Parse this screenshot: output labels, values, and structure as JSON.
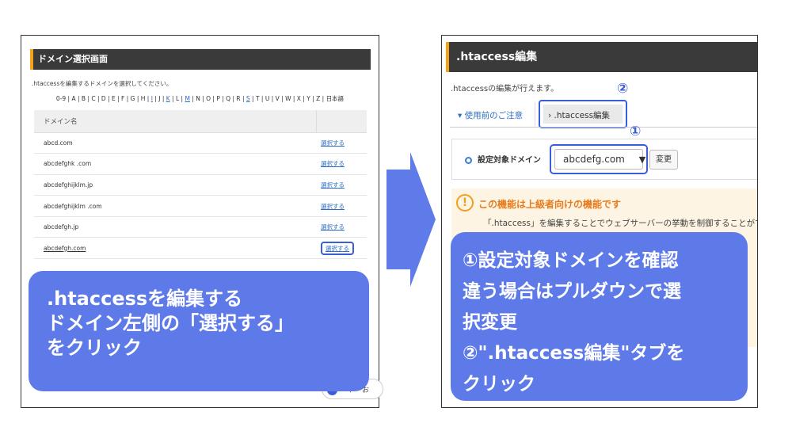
{
  "left_panel": {
    "header": "ドメイン選択画面",
    "instruction": ".htaccessを編集するドメインを選択してください。",
    "alpha_nav": [
      "0-9",
      "A",
      "B",
      "C",
      "D",
      "E",
      "F",
      "G",
      "H",
      "I",
      "J",
      "K",
      "L",
      "M",
      "N",
      "O",
      "P",
      "Q",
      "R",
      "S",
      "T",
      "U",
      "V",
      "W",
      "X",
      "Y",
      "Z",
      "日本語"
    ],
    "table": {
      "header": "ドメイン名",
      "rows": [
        {
          "domain": "abcd.com",
          "action": "選択する"
        },
        {
          "domain": "abcdefghk .com",
          "action": "選択する"
        },
        {
          "domain": "abcdefghijklm.jp",
          "action": "選択する"
        },
        {
          "domain": "abcdefghijklm .com",
          "action": "選択する"
        },
        {
          "domain": "abcdefgh.jp",
          "action": "選択する"
        },
        {
          "domain": "abcdefgh.com",
          "action": "選択する"
        }
      ]
    },
    "callout": [
      ".htaccessを編集する",
      "ドメイン左側の「選択する」",
      "をクリック"
    ],
    "support_button": "ート・お"
  },
  "right_panel": {
    "header": ".htaccess編集",
    "instruction": ".htaccessの編集が行えます。",
    "tabs": [
      "使用前のご注意",
      ".htaccess編集"
    ],
    "marker_1": "①",
    "marker_2": "②",
    "domain_label": "設定対象ドメイン",
    "domain_value": "abcdefg.com",
    "change_button": "変更",
    "warning_title": "この機能は上級者向けの機能です",
    "warning_text": "「.htaccess」を編集することでウェブサーバーの挙動を制御することがで",
    "callout": [
      "①設定対象ドメインを確認",
      "違う場合はプルダウンで選",
      "択変更",
      "②\".htaccess編集\"タブを",
      "クリック"
    ]
  },
  "colors": {
    "callout": "#5e7ae8",
    "arrow": "#5f7bea",
    "header_bg": "#3a3a3a",
    "header_accent": "#f5a21b",
    "link": "#2c6cc4",
    "highlight": "#3b5ed8",
    "warning": "#e87b1c"
  }
}
